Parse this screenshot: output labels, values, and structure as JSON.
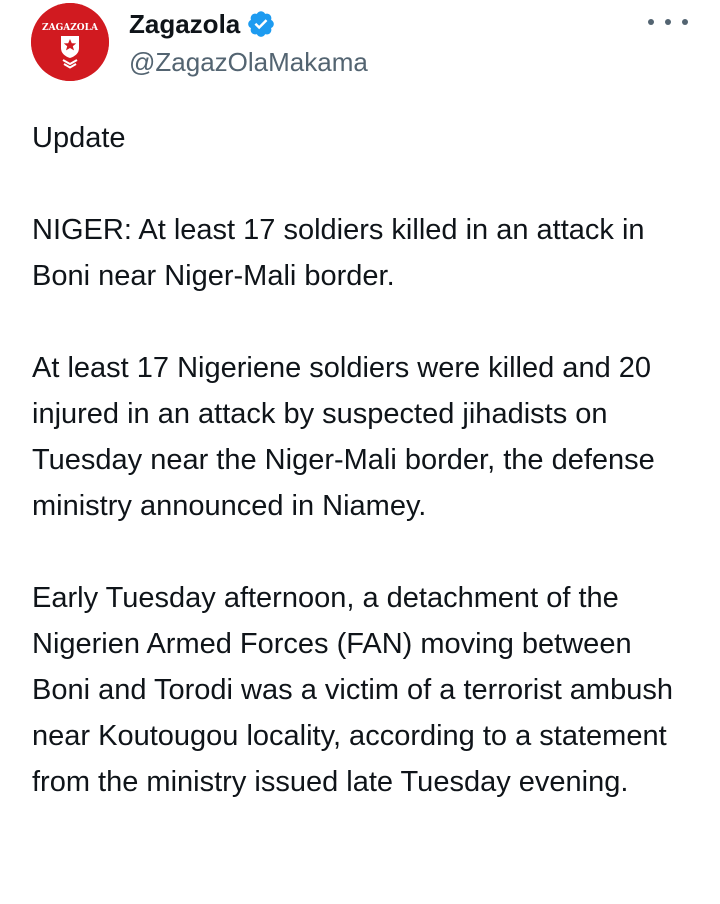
{
  "author": {
    "display_name": "Zagazola",
    "handle": "@ZagazOlaMakama",
    "verified": true,
    "avatar_text": "ZAGAZOLA",
    "avatar_color": "#d11a20",
    "verified_color": "#1d9bf0"
  },
  "actions": {
    "more_icon": "more-horizontal-icon"
  },
  "tweet": {
    "paragraphs": [
      "Update",
      "NIGER: At least 17 soldiers killed in an attack in Boni near Niger-Mali border.",
      "At least 17 Nigeriene soldiers were killed and 20 injured in an attack by suspected jihadists on Tuesday near the Niger-Mali border, the defense ministry announced in Niamey.",
      "Early Tuesday afternoon, a detachment of the Nigerien Armed Forces (FAN) moving between Boni and Torodi was a victim of a terrorist ambush near Koutougou locality, according to a statement from the ministry issued late Tuesday evening."
    ]
  }
}
